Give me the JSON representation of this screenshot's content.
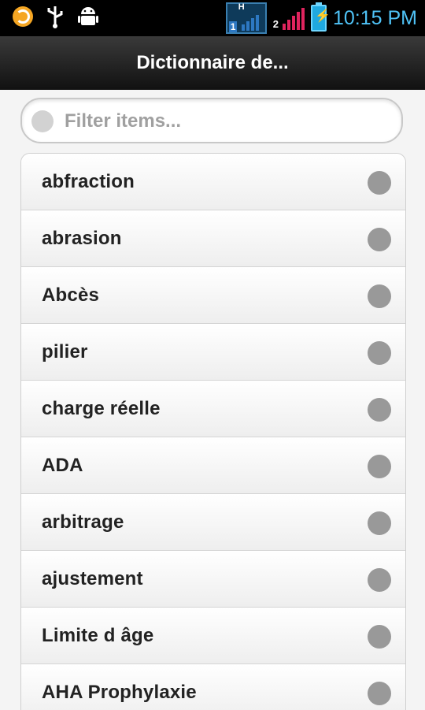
{
  "status_bar": {
    "time": "10:15 PM",
    "net_type": "H",
    "sim1": "1",
    "sim2": "2",
    "icons": [
      "app-notification-icon",
      "usb-icon",
      "android-debug-icon",
      "network-signal-icon",
      "signal-strength-icon",
      "battery-charging-icon"
    ],
    "colors": {
      "clock": "#4fc3f7",
      "signal2": "#e0245e",
      "network": "#2d78c2"
    }
  },
  "header": {
    "title": "Dictionnaire de..."
  },
  "filter": {
    "placeholder": "Filter items...",
    "value": ""
  },
  "items": [
    {
      "label": "abfraction"
    },
    {
      "label": "abrasion"
    },
    {
      "label": "Abcès"
    },
    {
      "label": "pilier"
    },
    {
      "label": "charge réelle"
    },
    {
      "label": "ADA"
    },
    {
      "label": "arbitrage"
    },
    {
      "label": "ajustement"
    },
    {
      "label": "Limite d âge"
    },
    {
      "label": "AHA Prophylaxie"
    }
  ]
}
